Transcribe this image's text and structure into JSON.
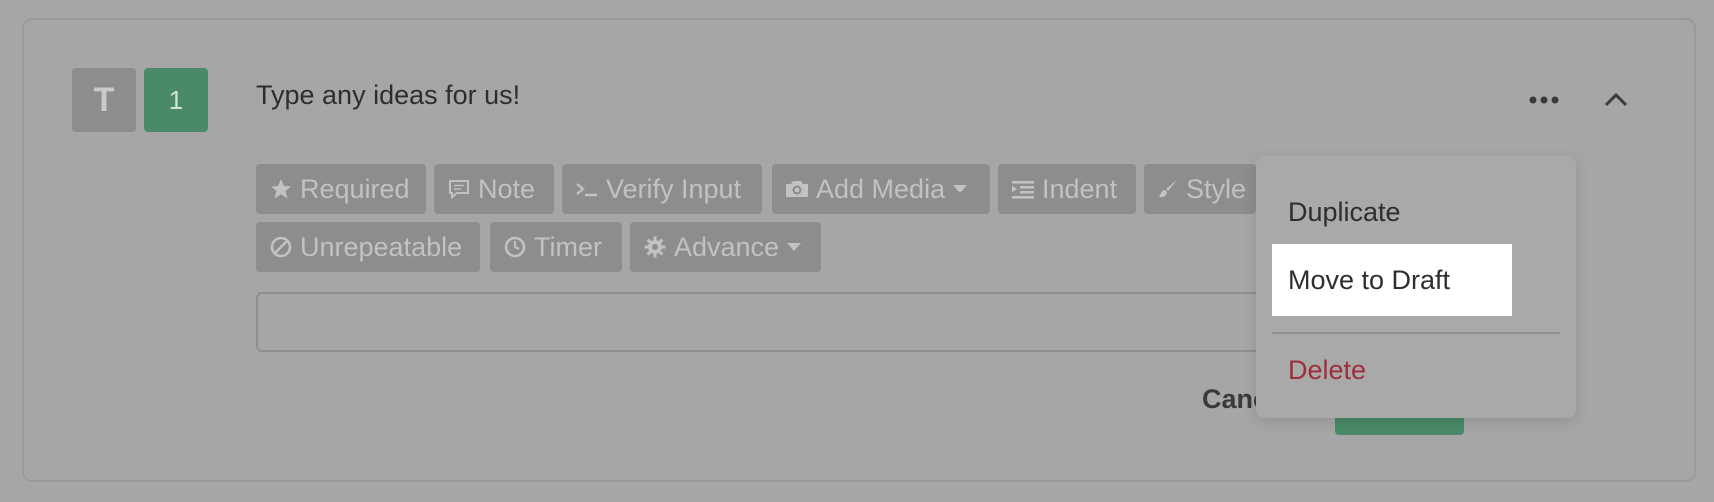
{
  "question": {
    "type_badge": "T",
    "number_badge": "1",
    "title": "Type any ideas for us!"
  },
  "toolbar": {
    "buttons": [
      {
        "label": "Required",
        "icon": "star-icon"
      },
      {
        "label": "Note",
        "icon": "comment-icon"
      },
      {
        "label": "Verify Input",
        "icon": "terminal-icon"
      },
      {
        "label": "Add Media",
        "icon": "camera-icon"
      },
      {
        "label": "Indent",
        "icon": "indent-icon"
      },
      {
        "label": "Style",
        "icon": "paintbrush-icon"
      },
      {
        "label": "Unrepeatable",
        "icon": "ban-icon"
      },
      {
        "label": "Timer",
        "icon": "clock-icon"
      },
      {
        "label": "Advance",
        "icon": "gear-icon"
      }
    ]
  },
  "answer": {
    "value": "",
    "placeholder": ""
  },
  "actions": {
    "cancel_label": "Cancel"
  },
  "menu": {
    "items": [
      {
        "label": "Duplicate"
      },
      {
        "label": "Move to Draft"
      },
      {
        "label": "Delete"
      }
    ]
  },
  "colors": {
    "overlay": "#a6a6a6",
    "brand_green": "#4a8a69",
    "danger_red": "#9e2f3a"
  }
}
